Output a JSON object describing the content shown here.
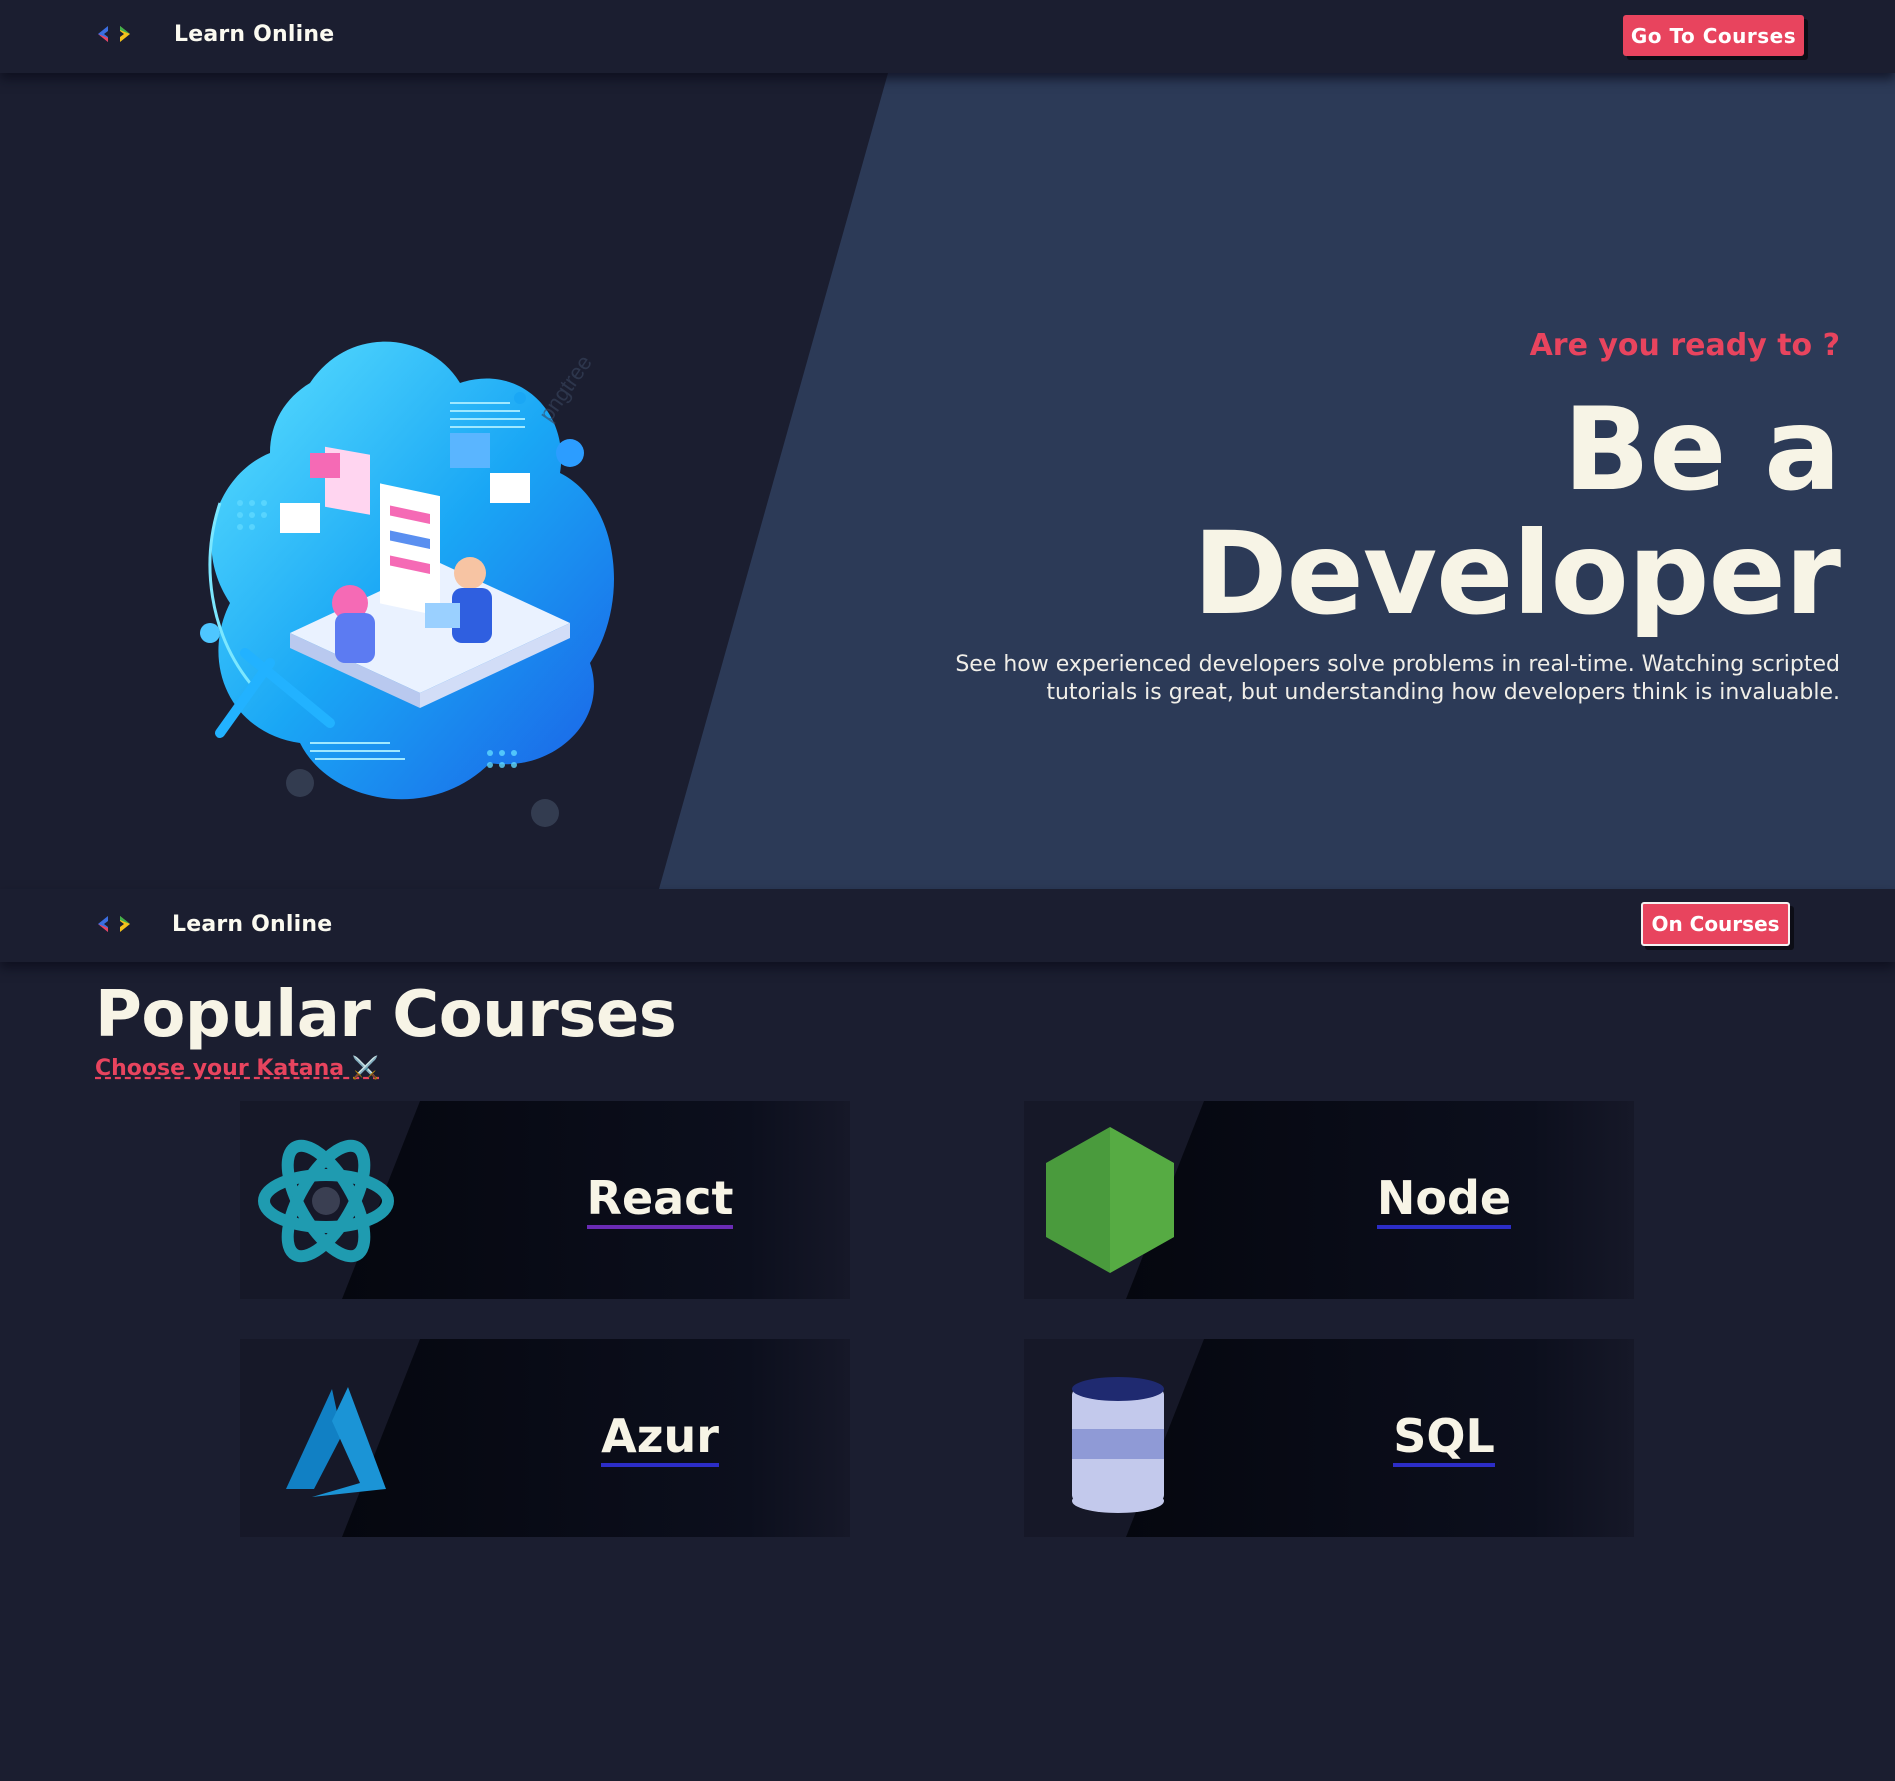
{
  "header": {
    "brand": "Learn Online",
    "cta_label": "Go To Courses"
  },
  "hero": {
    "kicker": "Are you ready to ?",
    "title_line1": "Be a",
    "title_line2": "Developer",
    "description": "See how experienced developers solve problems in real-time. Watching scripted tutorials is great, but understanding how developers think is invaluable.",
    "watermark": "pngtree"
  },
  "header2": {
    "brand": "Learn Online",
    "cta_label": "On Courses"
  },
  "courses": {
    "title": "Popular Courses",
    "subtitle": "Choose your Katana ⚔️",
    "items": [
      {
        "label": "React",
        "icon": "react-icon"
      },
      {
        "label": "Node",
        "icon": "nodejs-icon"
      },
      {
        "label": "Azur",
        "icon": "azure-icon"
      },
      {
        "label": "SQL",
        "icon": "database-icon"
      }
    ]
  },
  "colors": {
    "background": "#1b1e30",
    "hero_panel": "#2c3a57",
    "accent": "#e8445e",
    "text": "#f7f4e6",
    "underline": "#2c2dc7"
  }
}
